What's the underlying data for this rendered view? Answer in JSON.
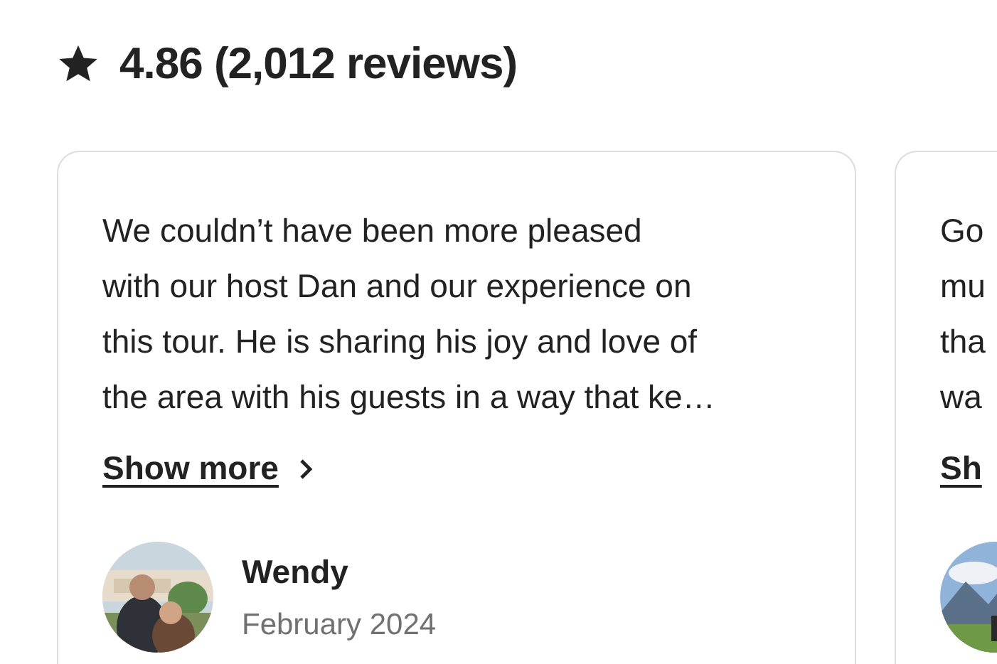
{
  "rating": {
    "text": "4.86 (2,012 reviews)"
  },
  "reviews": [
    {
      "text": "We couldn’t have been more pleased\nwith our host Dan and our experience on\nthis tour. He is sharing his joy and love of\nthe area with his guests in a way that ke…",
      "show_more": "Show more",
      "author": "Wendy",
      "date": "February 2024"
    },
    {
      "text": "Go\nmu\ntha\nwa",
      "show_more": "Sh"
    }
  ]
}
